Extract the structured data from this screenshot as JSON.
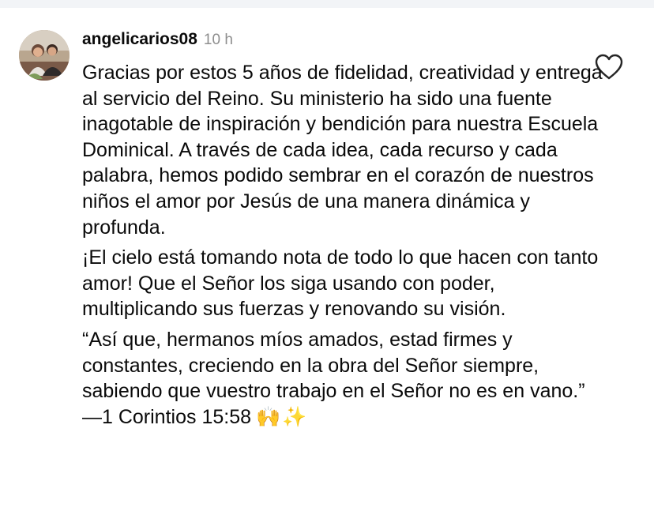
{
  "comment": {
    "username": "angelicarios08",
    "timestamp": "10 h",
    "paragraph1": "Gracias por estos 5 años de fidelidad, creatividad y entrega al servicio del Reino. Su ministerio ha sido una fuente inagotable de inspiración y bendición para nuestra Escuela Dominical. A través de cada idea, cada recurso y cada palabra, hemos podido sembrar en el corazón de nuestros niños el amor por Jesús de una manera dinámica y profunda.",
    "paragraph2": "¡El cielo está tomando nota de todo lo que hacen con tanto amor! Que el Señor los siga usando con poder, multiplicando sus fuerzas y renovando su visión.",
    "paragraph3": "“Así que, hermanos míos amados, estad firmes y constantes, creciendo en la obra del Señor siempre, sabiendo que vuestro trabajo en el Señor no es en vano.”",
    "reference": "—1 Corintios 15:58",
    "emoji_hands": "🙌",
    "emoji_sparkles": "✨"
  },
  "icons": {
    "like": "heart-outline-icon",
    "avatar": "profile-photo"
  },
  "colors": {
    "text": "#0a0a0a",
    "timestamp": "#8e8e8e",
    "top_band": "#f2f4f7"
  }
}
